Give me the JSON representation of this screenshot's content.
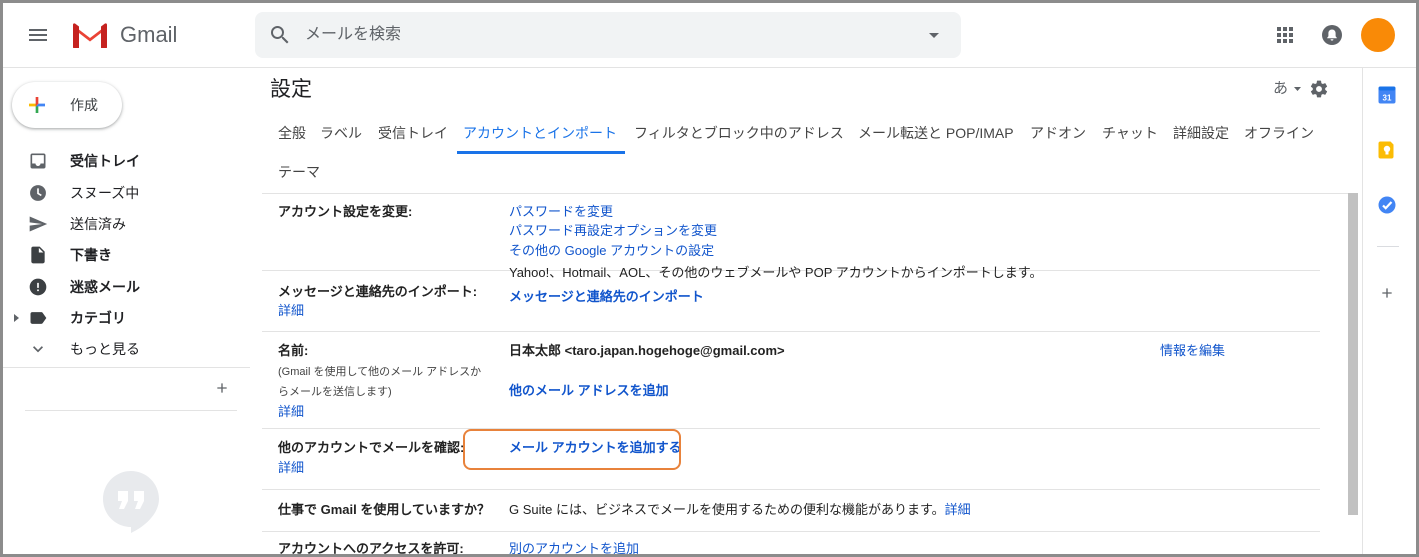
{
  "colors": {
    "accent_blue": "#1a73e8",
    "link_blue": "#1155cc",
    "brand_red": "#ea4335",
    "avatar_orange": "#f98a07",
    "highlight_orange": "#e8823b",
    "text_dark": "#202124",
    "text_gray": "#5f6368"
  },
  "header": {
    "menu_icon": "hamburger-menu-icon",
    "logo_icon": "gmail-logo-icon",
    "brand": "Gmail",
    "search_icon": "search-icon",
    "search_placeholder": "メールを検索",
    "search_options_icon": "caret-down-icon",
    "apps_icon": "apps-grid-icon",
    "notifications_icon": "notifications-icon"
  },
  "sidebar": {
    "compose_label": "作成",
    "items": [
      {
        "label": "受信トレイ",
        "icon": "inbox-icon"
      },
      {
        "label": "スヌーズ中",
        "icon": "snooze-clock-icon"
      },
      {
        "label": "送信済み",
        "icon": "send-icon"
      },
      {
        "label": "下書き",
        "icon": "draft-icon"
      },
      {
        "label": "迷惑メール",
        "icon": "spam-icon"
      },
      {
        "label": "カテゴリ",
        "icon": "label-icon"
      },
      {
        "label": "もっと見る",
        "icon": "chevron-down-icon"
      }
    ],
    "add_label_icon": "plus-icon",
    "hangouts_icon": "hangouts-icon"
  },
  "settings": {
    "title": "設定",
    "input_tool_label": "あ",
    "gear_icon": "gear-icon",
    "tabs": [
      {
        "label": "全般"
      },
      {
        "label": "ラベル"
      },
      {
        "label": "受信トレイ"
      },
      {
        "label": "アカウントとインポート",
        "active": true
      },
      {
        "label": "フィルタとブロック中のアドレス"
      },
      {
        "label": "メール転送と POP/IMAP"
      },
      {
        "label": "アドオン"
      },
      {
        "label": "チャット"
      },
      {
        "label": "詳細設定"
      },
      {
        "label": "オフライン"
      },
      {
        "label": "テーマ"
      }
    ],
    "rows": [
      {
        "heading": "アカウント設定を変更:",
        "links": [
          "パスワードを変更",
          "パスワード再設定オプションを変更",
          "その他の Google アカウントの設定"
        ]
      },
      {
        "heading": "メッセージと連絡先のインポート:",
        "help_link": "詳細",
        "description": "Yahoo!、Hotmail、AOL、その他のウェブメールや POP アカウントからインポートします。",
        "action_link": "メッセージと連絡先のインポート"
      },
      {
        "heading": "名前:",
        "note": [
          "(Gmail を使用して他のメール アドレスか",
          "らメールを送信します)"
        ],
        "help_link": "詳細",
        "value": "日本太郎 <taro.japan.hogehoge@gmail.com>",
        "edit_link": "情報を編集",
        "action_link": "他のメール アドレスを追加"
      },
      {
        "heading": "他のアカウントでメールを確認:",
        "help_link": "詳細",
        "action_link": "メール アカウントを追加する"
      },
      {
        "heading": "仕事で Gmail を使用していますか？",
        "description": "G Suite には、ビジネスでメールを使用するための便利な機能があります。",
        "help_link": "詳細"
      },
      {
        "heading": "アカウントへのアクセスを許可:",
        "action_link": "別のアカウントを追加"
      }
    ]
  },
  "side_panel": {
    "apps": [
      {
        "icon": "calendar-icon",
        "badge": "31"
      },
      {
        "icon": "keep-icon"
      },
      {
        "icon": "tasks-icon"
      }
    ],
    "add_icon": "plus-icon"
  }
}
